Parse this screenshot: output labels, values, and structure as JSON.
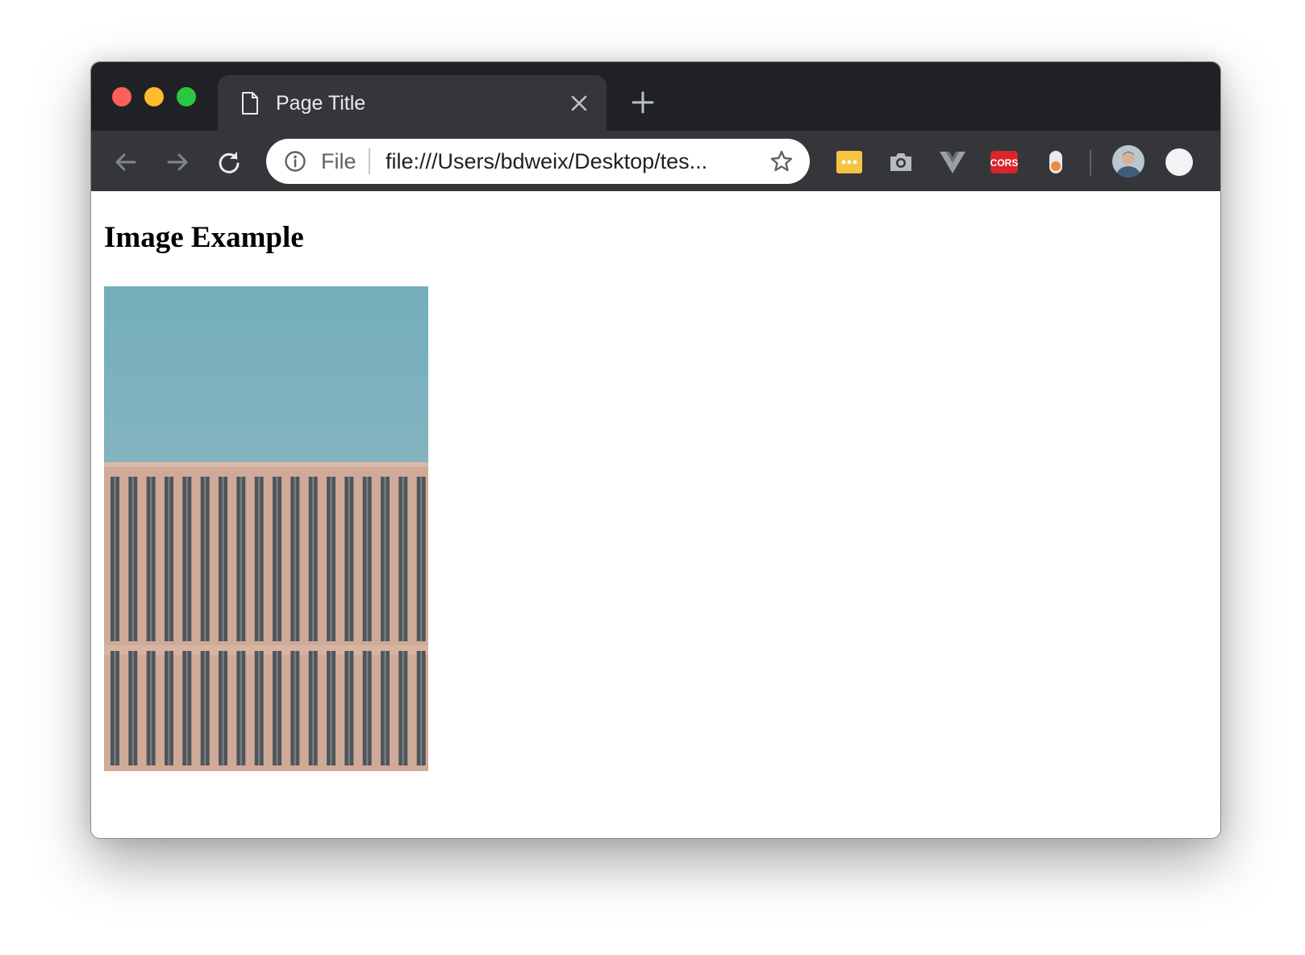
{
  "browser": {
    "tab": {
      "title": "Page Title"
    },
    "omnibox": {
      "scheme_label": "File",
      "url": "file:///Users/bdweix/Desktop/tes..."
    },
    "extensions": [
      "dots-extension",
      "camera-extension",
      "vue-devtools",
      "cors-extension",
      "toggle-extension"
    ],
    "extension_labels": {
      "cors": "CORS"
    }
  },
  "page": {
    "heading": "Image Example",
    "image": {
      "subject": "building facade under blue sky"
    }
  },
  "colors": {
    "tabstrip": "#202124",
    "toolbar": "#35363a",
    "sky": "#7eb2bd",
    "facade": "#cfaa98"
  }
}
